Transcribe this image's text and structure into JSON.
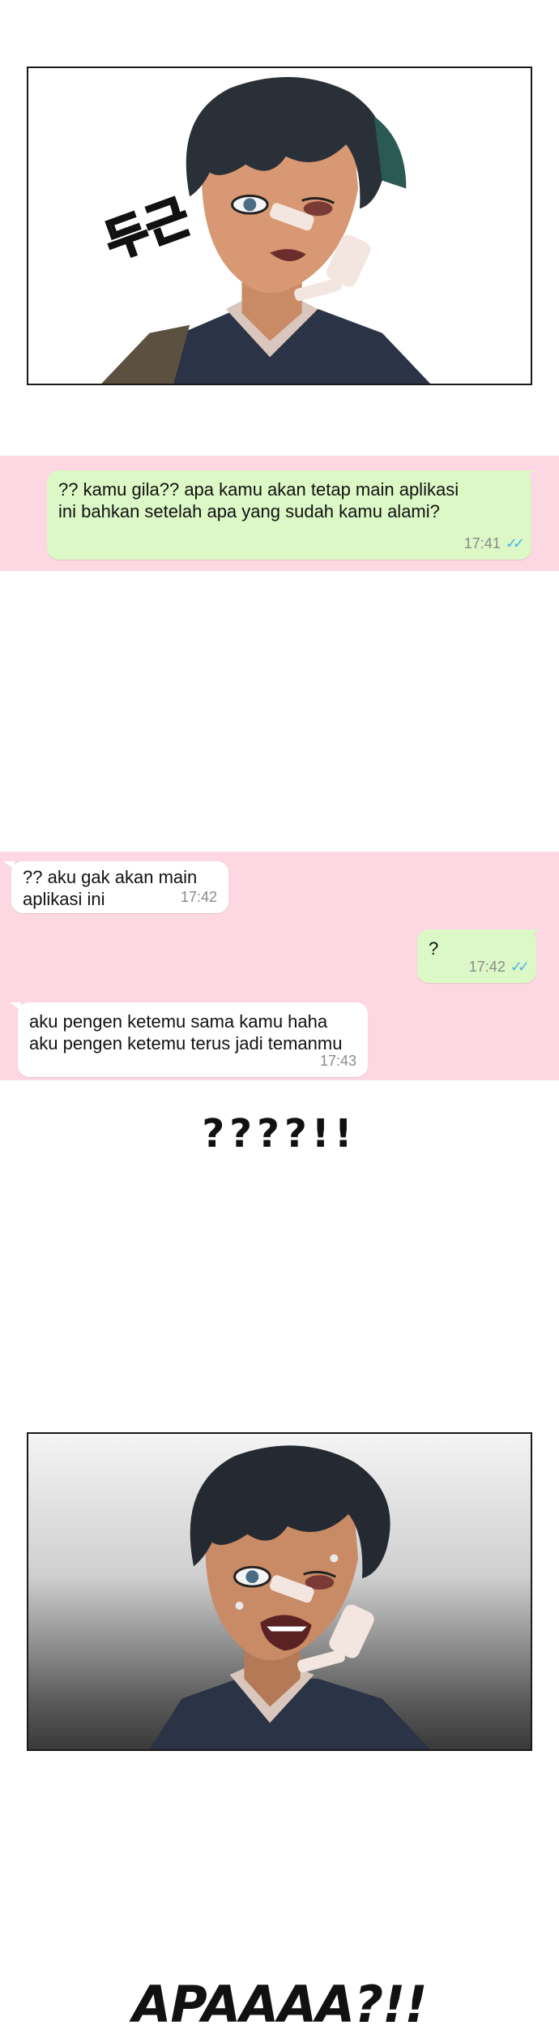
{
  "panel_1": {
    "sfx": "두근"
  },
  "chat_1": {
    "message": {
      "line1": "?? kamu gila?? apa kamu akan tetap main aplikasi",
      "line2": "ini bahkan setelah apa yang sudah kamu alami?",
      "time": "17:41"
    }
  },
  "chat_2": {
    "msg1": {
      "line1": "?? aku gak akan main",
      "line2": "aplikasi ini",
      "time": "17:42"
    },
    "msg2": {
      "text": "?",
      "time": "17:42"
    },
    "msg3": {
      "line1": "aku pengen ketemu sama kamu haha",
      "line2": "aku pengen ketemu terus jadi temanmu",
      "time": "17:43"
    }
  },
  "exclaim_1": "????!!",
  "exclaim_2": "APAAAA?!!",
  "colors": {
    "chat_bg": "#fdd8e2",
    "outgoing": "#dcf8c6",
    "incoming": "#ffffff",
    "read_ticks": "#4fb6ec"
  },
  "icons": {
    "read_receipt": "double-check-icon"
  }
}
